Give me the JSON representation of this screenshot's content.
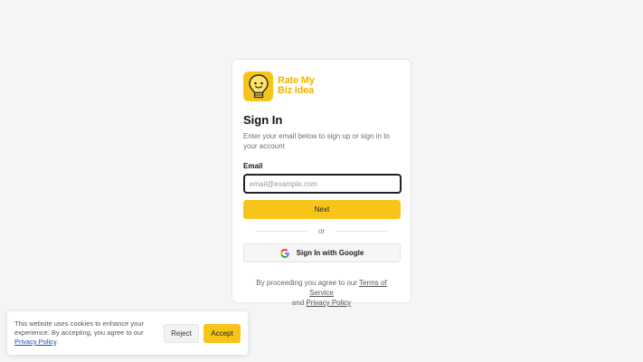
{
  "brand": {
    "line1": "Rate My",
    "line2": "Biz Idea",
    "logo_icon": "lightbulb-mascot-icon",
    "accent_color": "#f7c51a"
  },
  "signin": {
    "title": "Sign In",
    "subtitle": "Enter your email below to sign up or sign in to your account",
    "email_label": "Email",
    "email_placeholder": "email@example.com",
    "email_value": "",
    "next_label": "Next",
    "divider_text": "or",
    "google_label": "Sign In with Google",
    "google_icon": "google-g-icon"
  },
  "legal": {
    "prefix": "By proceeding you agree to our",
    "terms_label": "Terms of Service",
    "conjunction": "and",
    "privacy_label": "Privacy Policy"
  },
  "cookie_banner": {
    "text": "This website uses cookies to enhance your experience. By accepting, you agree to our",
    "policy_link": "Privacy Policy",
    "period": ".",
    "reject_label": "Reject",
    "accept_label": "Accept"
  }
}
